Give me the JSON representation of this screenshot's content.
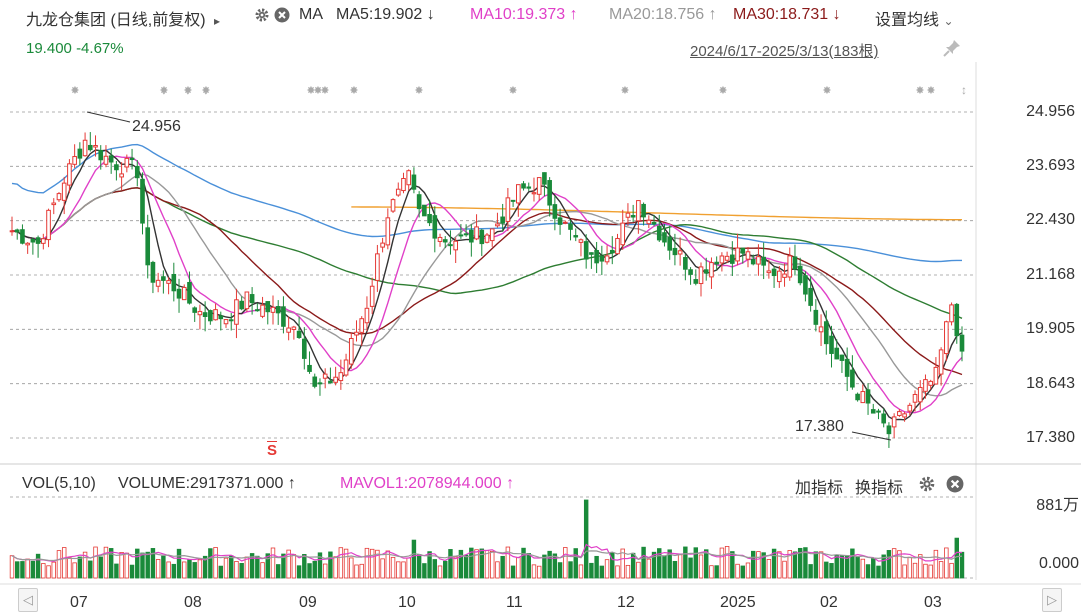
{
  "header": {
    "stock_title": "九龙仓集团 (日线,前复权)",
    "expand_arrow": "▸",
    "ma_label": "MA",
    "ma5": "MA5:19.902",
    "ma5_arrow": "↓",
    "ma10": "MA10:19.373",
    "ma10_arrow": "↑",
    "ma20": "MA20:18.756",
    "ma20_arrow": "↑",
    "ma30": "MA30:18.731",
    "ma30_arrow": "↓",
    "settings_label": "设置均线",
    "settings_chevron": "⌄",
    "price": "19.400",
    "change": "-4.67%",
    "date_range": "2024/6/17-2025/3/13(183根)",
    "icons": [
      "gear-icon",
      "close-icon",
      "pin-icon"
    ],
    "colors": {
      "ma5": "#333333",
      "ma10": "#e040c8",
      "ma20": "#999999",
      "ma30": "#8b1a1a",
      "ma60": "#2e7d32",
      "ma120": "#4a90d9",
      "ma250": "#f0a030",
      "up": "#e53935",
      "down": "#1a8a3a"
    }
  },
  "price_axis": [
    "24.956",
    "23.693",
    "22.430",
    "21.168",
    "19.905",
    "18.643",
    "17.380"
  ],
  "annotations": {
    "high": "24.956",
    "low": "17.380",
    "marker": "S"
  },
  "volume": {
    "title": "VOL(5,10)",
    "volume_text": "VOLUME:2917371.000",
    "volume_arrow": "↑",
    "mavol_text": "MAVOL1:2078944.000",
    "mavol_arrow": "↑",
    "add_indicator": "加指标",
    "switch_indicator": "换指标",
    "axis": [
      "881万",
      "0.000"
    ]
  },
  "x_axis": [
    "07",
    "08",
    "09",
    "10",
    "11",
    "12",
    "2025",
    "02",
    "03"
  ],
  "scroll": {
    "left": "◁",
    "right": "▷"
  },
  "chart_data": {
    "type": "candlestick",
    "title": "九龙仓集团 (日线,前复权)",
    "range": "2024/6/17-2025/3/13",
    "bars": 183,
    "ylim": [
      17.38,
      24.956
    ],
    "last_close": 19.4,
    "change_pct": -4.67,
    "high": 24.956,
    "low": 17.38,
    "moving_averages": {
      "MA5": 19.902,
      "MA10": 19.373,
      "MA20": 18.756,
      "MA30": 18.731
    },
    "volume": {
      "last": 2917371.0,
      "mavol1": 2078944.0,
      "axis_max": "881万"
    },
    "close_anchors": [
      [
        "2024-06-17",
        22.2
      ],
      [
        "2024-06-24",
        21.9
      ],
      [
        "2024-07-02",
        23.4
      ],
      [
        "2024-07-08",
        24.3
      ],
      [
        "2024-07-15",
        23.8
      ],
      [
        "2024-07-22",
        23.6
      ],
      [
        "2024-07-26",
        21.2
      ],
      [
        "2024-08-02",
        20.9
      ],
      [
        "2024-08-09",
        20.3
      ],
      [
        "2024-08-16",
        20.2
      ],
      [
        "2024-08-23",
        20.6
      ],
      [
        "2024-08-30",
        20.3
      ],
      [
        "2024-09-06",
        19.9
      ],
      [
        "2024-09-11",
        18.5
      ],
      [
        "2024-09-18",
        18.9
      ],
      [
        "2024-09-25",
        20.5
      ],
      [
        "2024-10-02",
        22.6
      ],
      [
        "2024-10-08",
        23.4
      ],
      [
        "2024-10-10",
        22.6
      ],
      [
        "2024-10-17",
        22.0
      ],
      [
        "2024-10-24",
        22.0
      ],
      [
        "2024-10-31",
        22.2
      ],
      [
        "2024-11-07",
        23.1
      ],
      [
        "2024-11-14",
        23.3
      ],
      [
        "2024-11-21",
        22.3
      ],
      [
        "2024-11-28",
        21.5
      ],
      [
        "2024-12-05",
        22.0
      ],
      [
        "2024-12-12",
        22.9
      ],
      [
        "2024-12-19",
        22.0
      ],
      [
        "2024-12-27",
        21.2
      ],
      [
        "2025-01-03",
        21.6
      ],
      [
        "2025-01-10",
        21.7
      ],
      [
        "2025-01-17",
        21.2
      ],
      [
        "2025-01-24",
        21.5
      ],
      [
        "2025-02-03",
        19.6
      ],
      [
        "2025-02-10",
        18.6
      ],
      [
        "2025-02-17",
        17.8
      ],
      [
        "2025-02-21",
        17.5
      ],
      [
        "2025-02-28",
        18.3
      ],
      [
        "2025-03-05",
        18.8
      ],
      [
        "2025-03-10",
        20.5
      ],
      [
        "2025-03-13",
        19.4
      ]
    ]
  }
}
